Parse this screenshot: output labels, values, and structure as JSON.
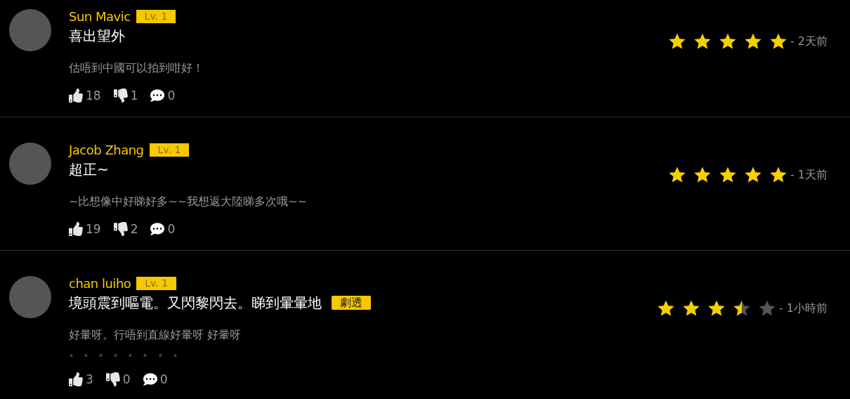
{
  "reviews": [
    {
      "user": "Sun Mavic",
      "level": "Lv. 1",
      "title": "喜出望外",
      "body": [
        "估唔到中國可以拍到咁好！"
      ],
      "stars": 5,
      "time": "- 2天前",
      "likes": "18",
      "dislikes": "1",
      "comments": "0"
    },
    {
      "user": "Jacob Zhang",
      "level": "Lv. 1",
      "title": "超正~",
      "body": [
        "~比想像中好睇好多~~我想返大陸睇多次哦~~"
      ],
      "stars": 5,
      "time": "- 1天前",
      "likes": "19",
      "dislikes": "2",
      "comments": "0"
    },
    {
      "user": "chan luiho",
      "level": "Lv. 1",
      "title": "境頭震到嘔電。又閃黎閃去。睇到暈暈地",
      "tags": [
        "劇透"
      ],
      "body": [
        "好暈呀。行唔到直線好暈呀 好暈呀",
        "。 。 。 。 。 。 。 。"
      ],
      "stars": 3.5,
      "time": "- 1小時前",
      "likes": "3",
      "dislikes": "0",
      "comments": "0"
    }
  ]
}
